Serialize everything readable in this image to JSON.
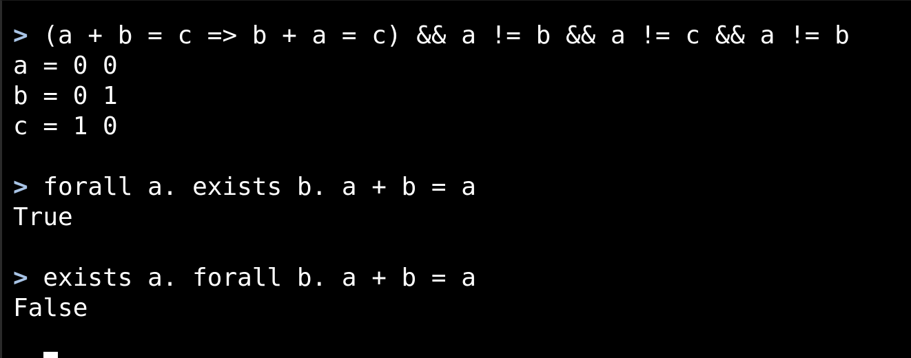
{
  "terminal": {
    "prompt_symbol": ">",
    "blocks": [
      {
        "command": "(a + b = c => b + a = c) && a != b && a != c && a != b",
        "output": [
          "a = 0 0",
          "b = 0 1",
          "c = 1 0"
        ]
      },
      {
        "command": "forall a. exists b. a + b = a",
        "output": [
          "True"
        ]
      },
      {
        "command": "exists a. forall b. a + b = a",
        "output": [
          "False"
        ]
      }
    ]
  },
  "colors": {
    "background": "#000000",
    "text": "#ffffff",
    "prompt": "#a8c4e6"
  }
}
